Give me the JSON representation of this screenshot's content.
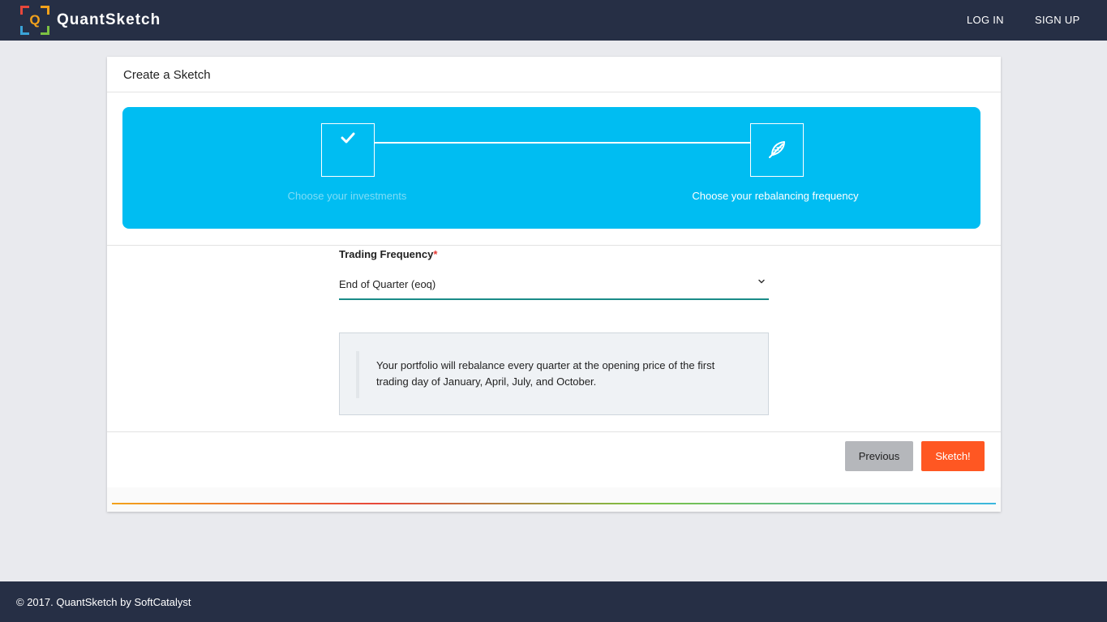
{
  "header": {
    "brand_letter": "Q",
    "brand_name": "QuantSketch",
    "nav": {
      "login": "LOG IN",
      "signup": "SIGN UP"
    }
  },
  "card": {
    "title": "Create a Sketch",
    "steps": [
      {
        "label": "Choose your investments",
        "icon": "check-icon",
        "status": "completed"
      },
      {
        "label": "Choose your rebalancing frequency",
        "icon": "feather-pen-icon",
        "status": "active"
      }
    ],
    "form": {
      "label": "Trading Frequency",
      "required_mark": "*",
      "selected_value": "End of Quarter (eoq)",
      "info_text": "Your portfolio will rebalance every quarter at the opening price of the first trading day of January, April, July, and October."
    },
    "buttons": {
      "previous": "Previous",
      "sketch": "Sketch!"
    }
  },
  "footer": {
    "text": "© 2017. QuantSketch by SoftCatalyst"
  },
  "colors": {
    "nav_bg": "#262f45",
    "stepper_bg": "#00bdf2",
    "accent_underline": "#1a8b88",
    "primary_button": "#ff5722",
    "secondary_button": "#b5b7bb"
  }
}
